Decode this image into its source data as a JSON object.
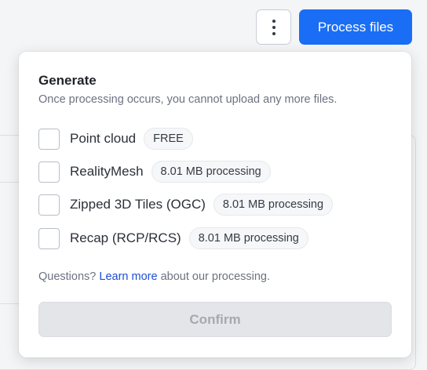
{
  "toolbar": {
    "more_icon": "vertical-ellipsis-icon",
    "process_label": "Process files",
    "accent_color": "#1a6ef5"
  },
  "popover": {
    "title": "Generate",
    "subtitle": "Once processing occurs, you cannot upload any more files.",
    "options": [
      {
        "label": "Point cloud",
        "badge": "FREE",
        "checked": false
      },
      {
        "label": "RealityMesh",
        "badge": "8.01 MB processing",
        "checked": false
      },
      {
        "label": "Zipped 3D Tiles (OGC)",
        "badge": "8.01 MB processing",
        "checked": false
      },
      {
        "label": "Recap (RCP/RCS)",
        "badge": "8.01 MB processing",
        "checked": false
      }
    ],
    "footer": {
      "prefix": "Questions?",
      "link": "Learn more",
      "suffix": "about our processing."
    },
    "confirm_label": "Confirm",
    "confirm_disabled": true
  }
}
